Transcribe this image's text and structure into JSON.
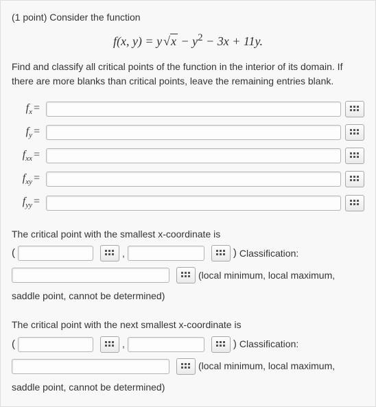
{
  "header": {
    "points_label": "(1 point)",
    "prompt_intro": "Consider the function"
  },
  "equation": "f(x, y) = y√x − y² − 3x + 11y.",
  "instructions": "Find and classify all critical points of the function in the interior of its domain. If there are more blanks than critical points, leave the remaining entries blank.",
  "derivs": {
    "fx_label": "f",
    "fx_sub": "x",
    "fy_label": "f",
    "fy_sub": "y",
    "fxx_label": "f",
    "fxx_sub": "xx",
    "fxy_label": "f",
    "fxy_sub": "xy",
    "fyy_label": "f",
    "fyy_sub": "yy",
    "eq": "="
  },
  "cp1": {
    "intro": "The critical point with the smallest x-coordinate is",
    "open": "(",
    "comma": ",",
    "close": ")",
    "class_label": "Classification:",
    "options_tail_1": "(local minimum, local maximum,",
    "options_tail_2": "saddle point, cannot be determined)"
  },
  "cp2": {
    "intro": "The critical point with the next smallest x-coordinate is",
    "open": "(",
    "comma": ",",
    "close": ")",
    "class_label": "Classification:",
    "options_tail_1": "(local minimum, local maximum,",
    "options_tail_2": "saddle point, cannot be determined)"
  }
}
